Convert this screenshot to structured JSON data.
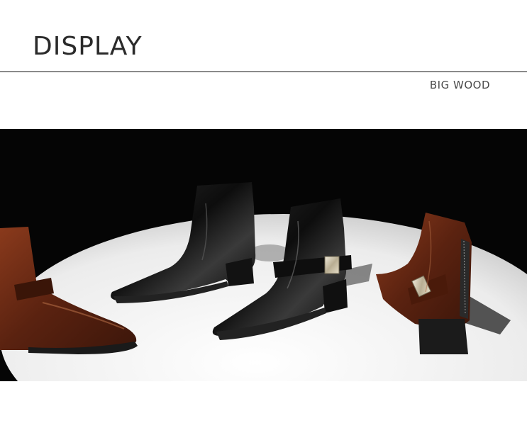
{
  "header": {
    "title": "DISPLAY",
    "brand": "BIG WOOD"
  },
  "photo": {
    "subject": "four ankle boots (black and brown leather) on a white round stage",
    "colors": {
      "background": "#050505",
      "stage": "#f2f2f2",
      "black_leather": "#111111",
      "brown_leather": "#6a2a14",
      "buckle": "#c9c2b0"
    }
  }
}
